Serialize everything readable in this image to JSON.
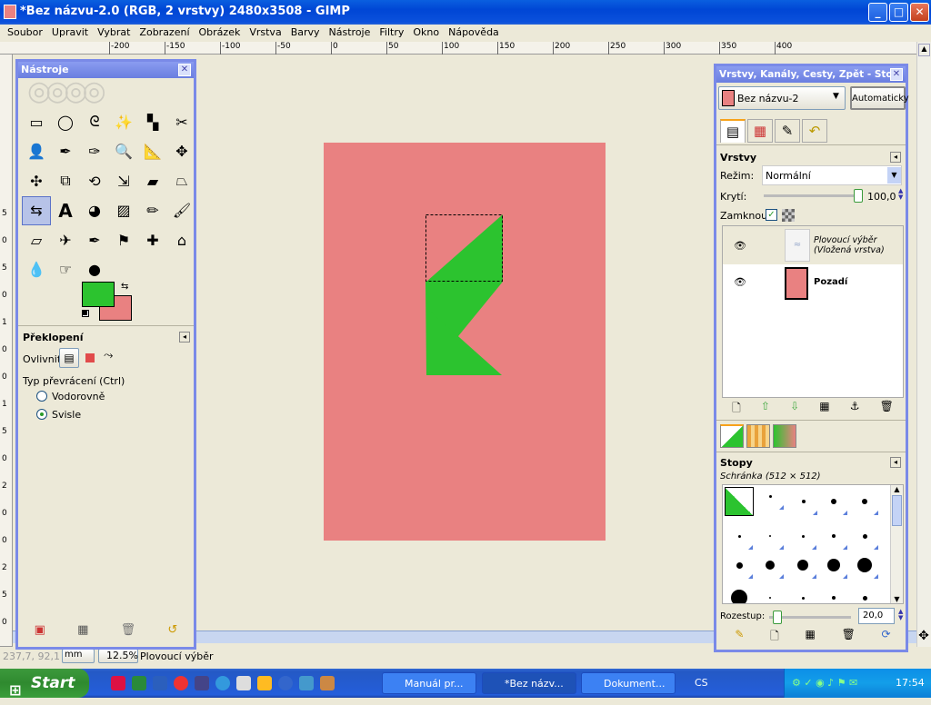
{
  "window": {
    "title": "*Bez názvu-2.0 (RGB, 2 vrstvy) 2480x3508 - GIMP",
    "minimize": "_",
    "maximize": "□",
    "close": "✕"
  },
  "menu": [
    "Soubor",
    "Upravit",
    "Vybrat",
    "Zobrazení",
    "Obrázek",
    "Vrstva",
    "Barvy",
    "Nástroje",
    "Filtry",
    "Okno",
    "Nápověda"
  ],
  "ruler": {
    "h_ticks": [
      "-200",
      "-150",
      "-100",
      "-50",
      "0",
      "50",
      "100",
      "150",
      "200",
      "250",
      "300",
      "350",
      "400"
    ],
    "v_ticks": [
      "5",
      "0",
      "5",
      "0",
      "1",
      "0",
      "0",
      "1",
      "5",
      "0",
      "2",
      "0",
      "0",
      "2",
      "5",
      "0"
    ]
  },
  "toolbox": {
    "title": "Nástroje",
    "option_title": "Překlopení",
    "affect_label": "Ovlivnit:",
    "type_label": "Typ převrácení  (Ctrl)",
    "radio_horizontal": "Vodorovně",
    "radio_vertical": "Svisle",
    "selected": "Svisle",
    "tools": [
      "rect-select",
      "ellipse-select",
      "free-select",
      "fuzzy-select",
      "color-select",
      "scissors",
      "foreground-select",
      "paths",
      "color-picker",
      "zoom",
      "measure",
      "move",
      "align",
      "crop",
      "rotate",
      "scale",
      "shear",
      "perspective",
      "flip",
      "text",
      "bucket-fill",
      "blend",
      "pencil",
      "paintbrush",
      "eraser",
      "airbrush",
      "ink",
      "clone",
      "heal",
      "perspective-clone",
      "blur",
      "smudge",
      "dodge-burn"
    ],
    "fg_color": "#2cc32f",
    "bg_color": "#e98181"
  },
  "status": {
    "coords": "237,7, 92,1",
    "unit": "mm",
    "zoom": "12.5%",
    "message": "Plovoucí výběr"
  },
  "layers_dock": {
    "title": "Vrstvy, Kanály, Cesty, Zpět - Sto...",
    "image_select": "Bez názvu-2",
    "auto_button": "Automaticky",
    "panel_title": "Vrstvy",
    "mode_label": "Režim:",
    "mode_value": "Normální",
    "opacity_label": "Krytí:",
    "opacity_value": "100,0",
    "opacity_fraction": 1.0,
    "lock_label": "Zamknout:",
    "layers": [
      {
        "name": "Plovoucí výběr\n(Vložená vrstva)",
        "italic": true
      },
      {
        "name": "Pozadí",
        "italic": false
      }
    ],
    "brushes_title": "Stopy",
    "brushes_sub": "Schránka (512 × 512)",
    "spacing_label": "Rozestup:",
    "spacing_value": "20,0",
    "spacing_fraction": 0.1
  },
  "taskbar": {
    "start": "Start",
    "tasks": [
      "Manuál pr...",
      "*Bez názv...",
      "Dokument..."
    ],
    "lang": "CS",
    "clock": "17:54"
  },
  "colors": {
    "canvas": "#e98181",
    "green": "#2cc32f"
  }
}
